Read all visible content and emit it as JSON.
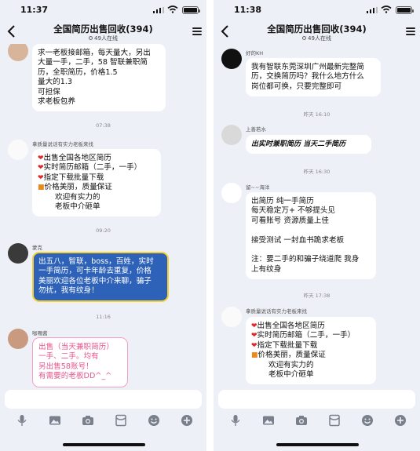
{
  "left": {
    "status": {
      "time": "11:37"
    },
    "nav": {
      "title": "全国简历出售回收(394)",
      "online": "49人在线"
    },
    "messages": {
      "m1": "求一老板接邮箱，每天量大，另出\n大量一手，二手，58 智联兼职简\n历，全职简历，价格1.5\n量大的1.3\n可担保\n求老板包养",
      "ts1": "07:38",
      "m2_sender": "拿质量说话有实力老板来找",
      "m2_lines": [
        "出售全国各地区简历",
        "实时简历邮箱（二手，一手）",
        "指定下载批量下载",
        "价格美丽，质量保证"
      ],
      "m2_tail": [
        "欢迎有实力的",
        "老板中介砸单"
      ],
      "ts2": "09:20",
      "m3_sender": "蒙克",
      "m3": "出五八，智联，boss，百姓，实时\n一手简历，可卡年龄去重复，价格\n美丽欢迎各位老板中介来聊，骗子\n勿扰，我有纹身！",
      "ts3": "11:16",
      "m4_sender": "咖喱酱",
      "m4": "出售（当天兼职简历）\n一手、二手。均有\n另出售58账号！\n有需要的老板DD^_^"
    }
  },
  "right": {
    "status": {
      "time": "11:38"
    },
    "nav": {
      "title": "全国简历出售回收(394)",
      "online": "49人在线"
    },
    "messages": {
      "m1_sender": "好的KH",
      "m1": "我有智联东莞深圳广州最新完整简\n历，交换简历吗？我什么地方什么\n岗位都可换，只要完整即可",
      "ts1": "昨天 16:10",
      "m2_sender": "上善若水",
      "m2": "出实时兼职简历 当天二手简历",
      "ts2": "昨天 16:30",
      "m3_sender": "留~~海洋",
      "m3": "出简历        纯一手简历\n每天稳定万+   不够提头见\n可看账号      资源质量上佳\n\n接受测试      一封血书跪求老板\n\n注：要二手的和骗子绕道爬 我身\n上有纹身",
      "ts3": "昨天 17:38",
      "m4_sender": "拿质量说话有实力老板来找",
      "m4_lines": [
        "出售全国各地区简历",
        "实时简历邮箱（二手，一手）",
        "指定下载批量下载",
        "价格美丽，质量保证"
      ],
      "m4_tail": [
        "欢迎有实力的",
        "老板中介砸单"
      ]
    }
  },
  "icons": {
    "heart": "❤",
    "gift": "🎁",
    "toolbar": [
      "mic-icon",
      "image-icon",
      "camera-icon",
      "red-packet-icon",
      "emoji-icon",
      "plus-icon"
    ]
  },
  "colors": {
    "chat_bg": "#eef0f7",
    "blue_bubble": "#2d62b8",
    "blue_bubble_border": "#f5d02e",
    "pink_text": "#e8558e",
    "heart": "#e02828"
  }
}
